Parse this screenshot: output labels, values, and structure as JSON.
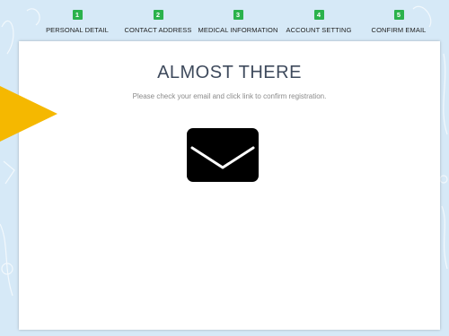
{
  "steps": [
    {
      "number": "1",
      "label": "PERSONAL DETAIL"
    },
    {
      "number": "2",
      "label": "CONTACT ADDRESS"
    },
    {
      "number": "3",
      "label": "MEDICAL INFORMATION"
    },
    {
      "number": "4",
      "label": "ACCOUNT SETTING"
    },
    {
      "number": "5",
      "label": "CONFIRM EMAIL"
    }
  ],
  "card": {
    "title": "ALMOST THERE",
    "subtitle": "Please check your email and click link to confirm registration."
  },
  "icons": {
    "envelope": "envelope-icon",
    "arrow": "arrow-icon"
  },
  "colors": {
    "step_badge": "#2bb24c",
    "arrow": "#f5b800",
    "background": "#d6e9f7",
    "title": "#3e4a5c"
  }
}
